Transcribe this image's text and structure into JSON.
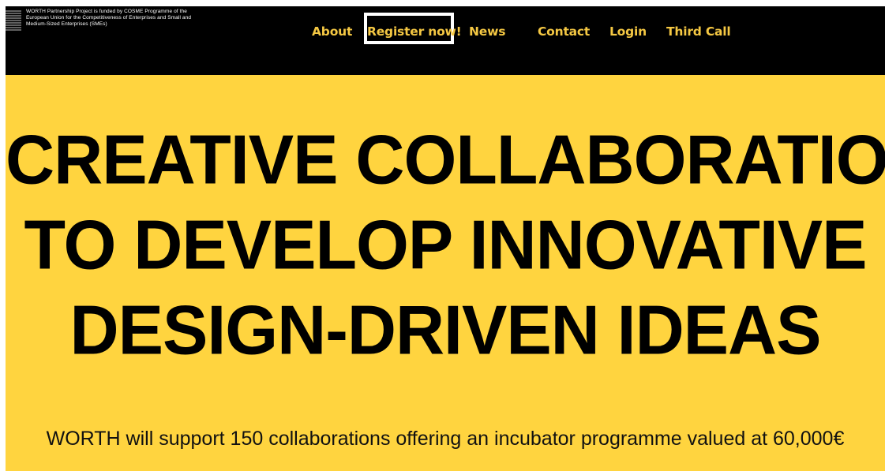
{
  "header": {
    "eu_notice": "WORTH Partnership Project is funded by COSME Programme of the European Union for the Competitiveness of Enterprises and Small and Medium-Sized Enterprises (SMEs)",
    "nav": {
      "about": "About",
      "register": "Register now!",
      "news": "News",
      "contact": "Contact",
      "login": "Login",
      "third_call": "Third Call"
    }
  },
  "hero": {
    "headline_lines": [
      "CREATIVE COLLABORATIONS",
      "TO DEVELOP INNOVATIVE",
      "DESIGN-DRIVEN IDEAS"
    ],
    "subtext": "WORTH will support 150 collaborations offering an incubator programme valued at 60,000€"
  },
  "colors": {
    "header_bg": "#000000",
    "nav_text": "#f5c843",
    "hero_bg": "#ffd43f",
    "headline_text": "#000000"
  }
}
